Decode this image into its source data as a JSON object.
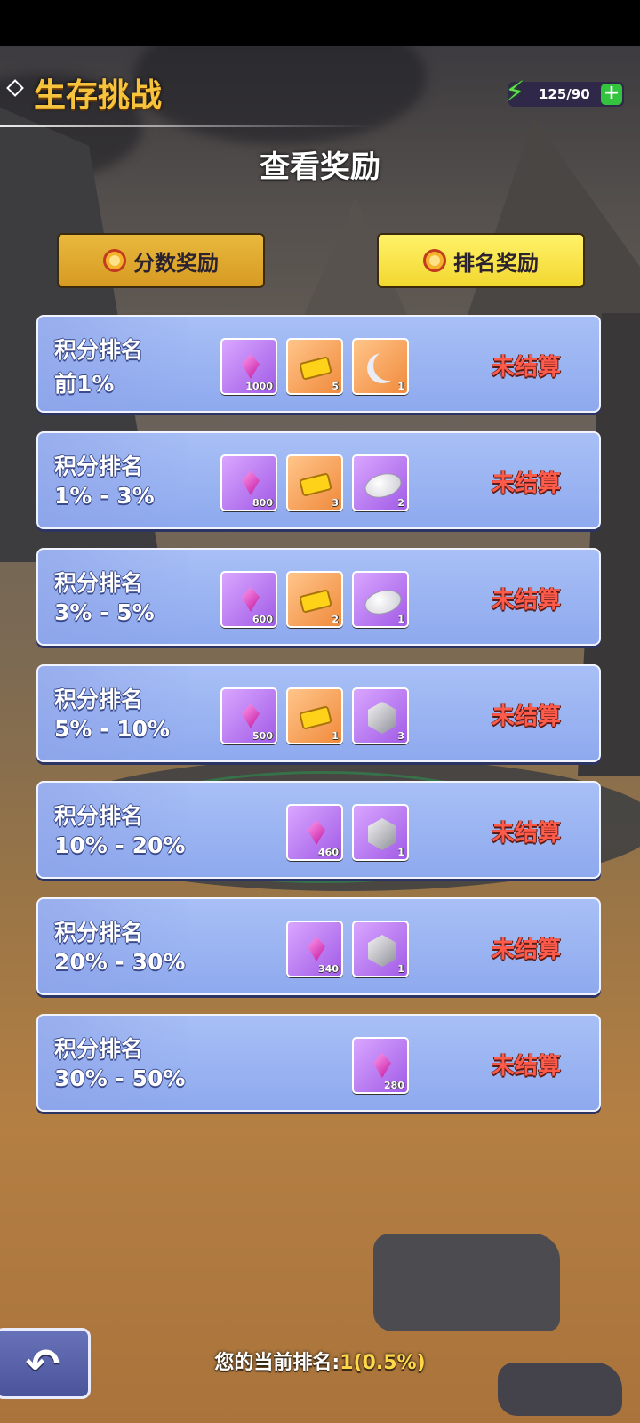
{
  "header": {
    "title": "生存挑战",
    "energy": "125/90",
    "energy_plus": "+"
  },
  "page_heading": "查看奖励",
  "tabs": {
    "score_label": "分数奖励",
    "rank_label": "排名奖励"
  },
  "tiers": [
    {
      "title": "积分排名",
      "range": "前1%",
      "status": "未结算",
      "rewards": [
        {
          "icon": "purple-gem-icon",
          "count": "1000"
        },
        {
          "icon": "gold-ticket-icon",
          "count": "5"
        },
        {
          "icon": "moon-icon",
          "count": "1"
        }
      ]
    },
    {
      "title": "积分排名",
      "range": "1% - 3%",
      "status": "未结算",
      "rewards": [
        {
          "icon": "purple-gem-icon",
          "count": "800"
        },
        {
          "icon": "gold-ticket-icon",
          "count": "3"
        },
        {
          "icon": "silver-stone-icon",
          "count": "2"
        }
      ]
    },
    {
      "title": "积分排名",
      "range": "3% - 5%",
      "status": "未结算",
      "rewards": [
        {
          "icon": "purple-gem-icon",
          "count": "600"
        },
        {
          "icon": "gold-ticket-icon",
          "count": "2"
        },
        {
          "icon": "silver-stone-icon",
          "count": "1"
        }
      ]
    },
    {
      "title": "积分排名",
      "range": "5% - 10%",
      "status": "未结算",
      "rewards": [
        {
          "icon": "purple-gem-icon",
          "count": "500"
        },
        {
          "icon": "gold-ticket-icon",
          "count": "1"
        },
        {
          "icon": "silver-hexgem-icon",
          "count": "3"
        }
      ]
    },
    {
      "title": "积分排名",
      "range": "10% - 20%",
      "status": "未结算",
      "rewards": [
        {
          "icon": "purple-gem-icon",
          "count": "460"
        },
        {
          "icon": "silver-hexgem-icon",
          "count": "1"
        }
      ]
    },
    {
      "title": "积分排名",
      "range": "20% - 30%",
      "status": "未结算",
      "rewards": [
        {
          "icon": "purple-gem-icon",
          "count": "340"
        },
        {
          "icon": "silver-hexgem-icon",
          "count": "1"
        }
      ]
    },
    {
      "title": "积分排名",
      "range": "30% - 50%",
      "status": "未结算",
      "rewards": [
        {
          "icon": "purple-gem-icon",
          "count": "280"
        }
      ]
    }
  ],
  "footer": {
    "rank_label": "您的当前排名:",
    "rank_value": "1(0.5%)"
  },
  "colors": {
    "title_gold": "#f7c23c",
    "card_blue": "#9bb4f2",
    "status_red": "#ff5a4a",
    "tab_active": "#f7e24a"
  }
}
